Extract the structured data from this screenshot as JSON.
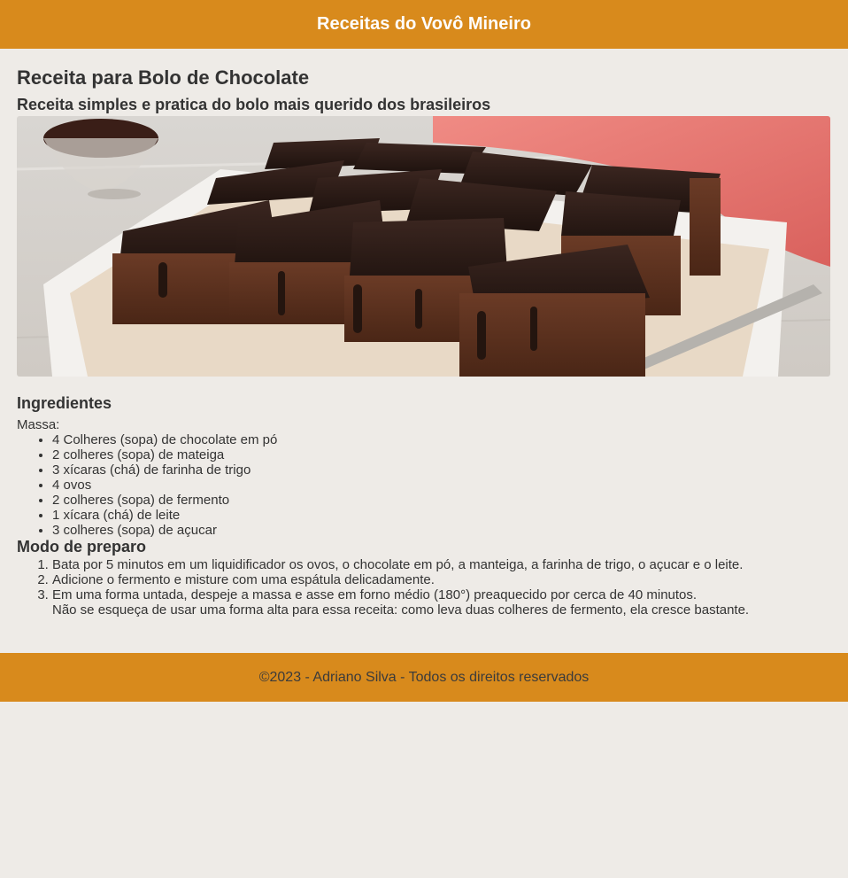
{
  "header": {
    "site_title": "Receitas do Vovô Mineiro",
    "bg_color": "#d88a1c"
  },
  "recipe": {
    "title": "Receita para Bolo de Chocolate",
    "subtitle": "Receita simples e pratica do bolo mais querido dos brasileiros",
    "image": "chocolate-cake-squares-photo"
  },
  "ingredients": {
    "heading": "Ingredientes",
    "group_label": "Massa:",
    "items": [
      "4 Colheres (sopa) de chocolate em pó",
      "2 colheres (sopa) de mateiga",
      "3 xícaras (chá) de farinha de trigo",
      "4 ovos",
      "2 colheres (sopa) de fermento",
      "1 xícara (chá) de leite",
      "3 colheres (sopa) de açucar"
    ]
  },
  "preparation": {
    "heading": "Modo de preparo",
    "steps": [
      "Bata por 5 minutos em um liquidificador os ovos, o chocolate em pó, a manteiga, a farinha de trigo, o açucar e o leite.",
      "Adicione o fermento e misture com uma espátula delicadamente.",
      "Em uma forma untada, despeje a massa e asse em forno médio (180°) preaquecido por cerca de 40 minutos."
    ],
    "note": "Não se esqueça de usar uma forma alta para essa receita: como leva duas colheres de fermento, ela cresce bastante."
  },
  "footer": {
    "text": "©2023 - Adriano Silva - Todos os direitos reservados"
  },
  "colors": {
    "page_bg": "#eeebe7",
    "accent": "#d88a1c",
    "text": "#333333"
  }
}
